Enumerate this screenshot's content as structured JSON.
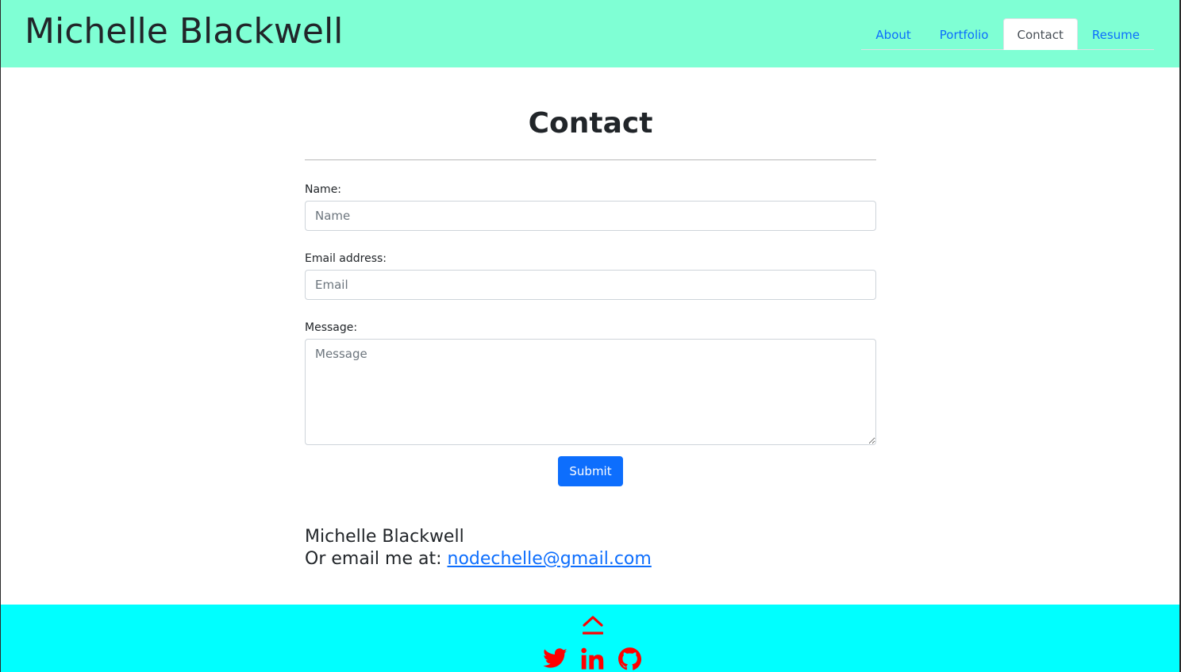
{
  "header": {
    "site_title": "Michelle Blackwell",
    "nav": [
      {
        "label": "About",
        "active": false
      },
      {
        "label": "Portfolio",
        "active": false
      },
      {
        "label": "Contact",
        "active": true
      },
      {
        "label": "Resume",
        "active": false
      }
    ]
  },
  "main": {
    "title": "Contact",
    "form": {
      "name_label": "Name:",
      "name_placeholder": "Name",
      "email_label": "Email address:",
      "email_placeholder": "Email",
      "message_label": "Message:",
      "message_placeholder": "Message",
      "submit_label": "Submit"
    },
    "contact": {
      "name": "Michelle Blackwell",
      "email_prefix": "Or email me at:",
      "email": "nodechelle@gmail.com"
    }
  },
  "footer": {
    "icons": [
      "chevron-up-icon",
      "twitter-icon",
      "linkedin-icon",
      "github-icon"
    ]
  },
  "colors": {
    "header_bg": "#7fffd4",
    "footer_bg": "#00ffff",
    "link": "#0d6efd",
    "icon": "#ff0000"
  }
}
